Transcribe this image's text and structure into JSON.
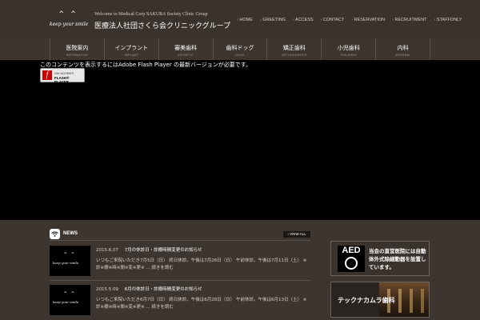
{
  "header": {
    "logo_face": "^ ^",
    "logo_script": "keep your smile",
    "tagline": "Welcome to Medical Corp SAKURA Society Clinic Group",
    "clinic_name": "医療法人社団さくら会クリニックグループ",
    "top_links": [
      "HOME",
      "GREETING",
      "ACCESS",
      "CONTACT",
      "RESERVATION",
      "RECRUITMENT",
      "STAFFONLY"
    ]
  },
  "nav": [
    {
      "jp": "医院案内",
      "en": "INFORMATION"
    },
    {
      "jp": "インプラント",
      "en": "IMPLANT"
    },
    {
      "jp": "審美歯科",
      "en": "ESTHETIC"
    },
    {
      "jp": "歯科ドッグ",
      "en": "DOCK"
    },
    {
      "jp": "矯正歯科",
      "en": "ORTHODONTICS"
    },
    {
      "jp": "小児歯科",
      "en": "CHILDREN"
    },
    {
      "jp": "内科",
      "en": "INTERNAL"
    }
  ],
  "flash": {
    "message": "このコンテンツを表示するにはAdobe Flash Player の最新バージョンが必要です。",
    "badge_line1": "Get ADOBE®",
    "badge_line2": "FLASH® PLAYER",
    "badge_letter": "f"
  },
  "news": {
    "title": "NEWS",
    "view_all": "› VIEW ALL",
    "items": [
      {
        "date": "2015.6.07",
        "title": "7月の休診日・診療時間変更のお知らせ",
        "body": "いつもご来院いただき7月5日（日） 終日休診。午後は7月26日（日） 午前休診。午後は7月11日（土） ※診※療※時※間※変※更※ ... 続きを読む",
        "thumb_face": "^ ^",
        "thumb_script": "keep your smile"
      },
      {
        "date": "2015.5.09",
        "title": "6月の休診日・診療時間変更のお知らせ",
        "body": "いつもご来院いただき6月7日（日） 終日休診。午後は6月28日（日） 午前休診。午後は6月13日（土） ※診※療※時※間※変※更※ ... 続きを読む",
        "thumb_face": "^ ^",
        "thumb_script": "keep your smile"
      }
    ]
  },
  "sidebar": {
    "aed_logo": "AED",
    "aed_text": "当会の直営医院には自動体外式除細動器を設置しています。",
    "clinic_label": "テックナカムラ歯科"
  }
}
